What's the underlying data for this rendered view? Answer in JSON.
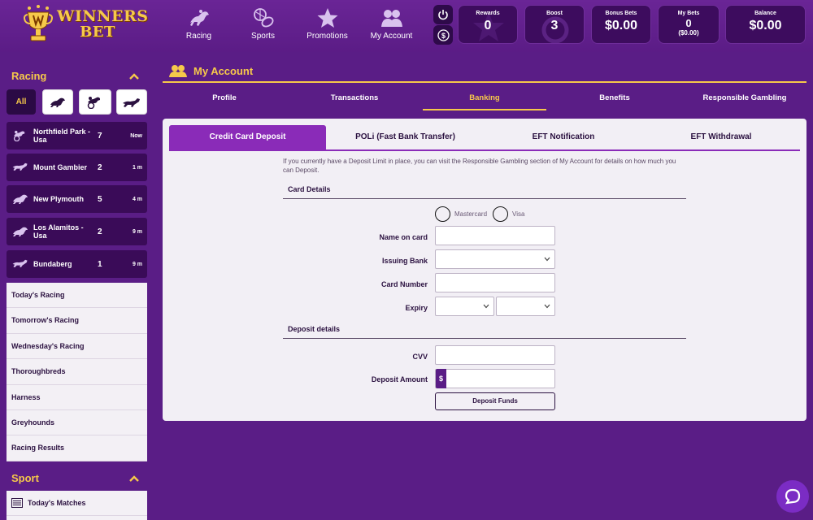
{
  "brand": {
    "line1": "WINNERS",
    "line2": "BET"
  },
  "nav": [
    {
      "label": "Racing",
      "icon": "horse-racing-icon"
    },
    {
      "label": "Sports",
      "icon": "sports-balls-icon"
    },
    {
      "label": "Promotions",
      "icon": "star-icon"
    },
    {
      "label": "My Account",
      "icon": "users-icon"
    }
  ],
  "stats": {
    "rewards": {
      "label": "Rewards",
      "value": "0"
    },
    "boost": {
      "label": "Boost",
      "value": "3"
    },
    "bonus_bets": {
      "label": "Bonus Bets",
      "value": "$0.00"
    },
    "my_bets": {
      "label": "My Bets",
      "value": "0",
      "sub": "($0.00)"
    },
    "balance": {
      "label": "Balance",
      "value": "$0.00"
    }
  },
  "sidebar": {
    "racing_heading": "Racing",
    "filter_all": "All",
    "races": [
      {
        "name": "Northfield Park - Usa",
        "number": "7",
        "time": "Now",
        "icon": "harness-icon"
      },
      {
        "name": "Mount Gambier",
        "number": "2",
        "time": "1 m",
        "icon": "greyhound-icon"
      },
      {
        "name": "New Plymouth",
        "number": "5",
        "time": "4 m",
        "icon": "horse-icon"
      },
      {
        "name": "Los Alamitos - Usa",
        "number": "2",
        "time": "9 m",
        "icon": "horse-icon"
      },
      {
        "name": "Bundaberg",
        "number": "1",
        "time": "9 m",
        "icon": "greyhound-icon"
      }
    ],
    "links": [
      "Today's Racing",
      "Tomorrow's Racing",
      "Wednesday's Racing",
      "Thoroughbreds",
      "Harness",
      "Greyhounds",
      "Racing Results"
    ],
    "sport_heading": "Sport",
    "sport_links": [
      "Today's Matches"
    ]
  },
  "account": {
    "title": "My Account",
    "tabs": [
      "Profile",
      "Transactions",
      "Banking",
      "Benefits",
      "Responsible Gambling"
    ],
    "active_tab": "Banking"
  },
  "banking": {
    "subtabs": [
      "Credit Card Deposit",
      "POLi (Fast Bank Transfer)",
      "EFT Notification",
      "EFT Withdrawal"
    ],
    "active_subtab": "Credit Card Deposit",
    "notice": "If you currently have a Deposit Limit in place, you can visit the Responsible Gambling section of My Account for details on how much you can Deposit.",
    "card_details_title": "Card Details",
    "card_types": [
      "Mastercard",
      "Visa"
    ],
    "fields": {
      "name_on_card": {
        "label": "Name on card",
        "value": ""
      },
      "issuing_bank": {
        "label": "Issuing Bank",
        "value": ""
      },
      "card_number": {
        "label": "Card Number",
        "value": ""
      },
      "expiry": {
        "label": "Expiry",
        "month": "",
        "year": ""
      }
    },
    "deposit_details_title": "Deposit details",
    "cvv": {
      "label": "CVV",
      "value": ""
    },
    "deposit_amount": {
      "label": "Deposit Amount",
      "prefix": "$",
      "value": ""
    },
    "submit_label": "Deposit Funds"
  },
  "colors": {
    "background": "#5a1d86",
    "accent_gold": "#f6c94a",
    "active_tab": "#8a2bb8",
    "panel": "#f2eff5"
  }
}
